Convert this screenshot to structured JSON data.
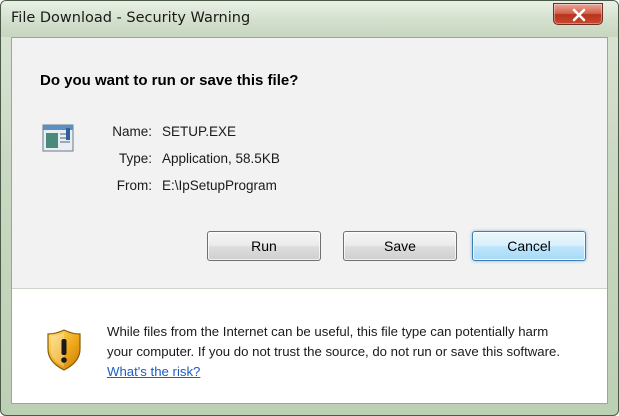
{
  "window": {
    "title": "File Download - Security Warning",
    "close_label": "X"
  },
  "dialog": {
    "question": "Do you want to run or save this file?",
    "file_icon": "application-window-icon",
    "fields": [
      {
        "label": "Name:",
        "value": "SETUP.EXE"
      },
      {
        "label": "Type:",
        "value": "Application, 58.5KB"
      },
      {
        "label": "From:",
        "value": "E:\\IpSetupProgram"
      }
    ],
    "buttons": {
      "run": "Run",
      "save": "Save",
      "cancel": "Cancel"
    }
  },
  "warning": {
    "icon": "security-shield-icon",
    "text": "While files from the Internet can be useful, this file type can potentially harm your computer. If you do not trust the source, do not run or save this software. ",
    "link": "What's the risk?"
  },
  "colors": {
    "link": "#1c5cc4",
    "close_button": "#c9492f",
    "default_button_border": "#3c7fb1"
  }
}
